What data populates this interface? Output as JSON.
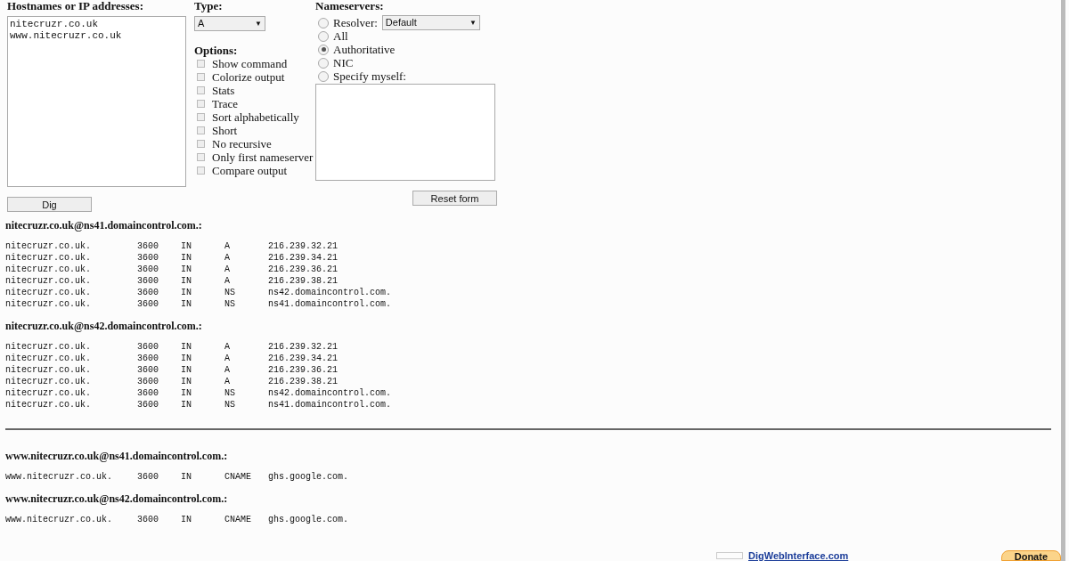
{
  "form": {
    "hostnames": {
      "label": "Hostnames or IP addresses:",
      "value": "nitecruzr.co.uk\nwww.nitecruzr.co.uk"
    },
    "dig_button": "Dig",
    "type": {
      "label": "Type:",
      "value": "A",
      "caret": "▼"
    },
    "options_label": "Options:",
    "options": [
      {
        "label": "Show command",
        "checked": false
      },
      {
        "label": "Colorize output",
        "checked": false
      },
      {
        "label": "Stats",
        "checked": false
      },
      {
        "label": "Trace",
        "checked": false
      },
      {
        "label": "Sort alphabetically",
        "checked": false
      },
      {
        "label": "Short",
        "checked": false
      },
      {
        "label": "No recursive",
        "checked": false
      },
      {
        "label": "Only first nameserver",
        "checked": false
      },
      {
        "label": "Compare output",
        "checked": false
      }
    ],
    "nameservers": {
      "label": "Nameservers:",
      "choices": [
        {
          "label": "Resolver:",
          "selected": false,
          "kind": "select",
          "value": "Default",
          "caret": "▼"
        },
        {
          "label": "All",
          "selected": false,
          "kind": "plain"
        },
        {
          "label": "Authoritative",
          "selected": true,
          "kind": "plain"
        },
        {
          "label": "NIC",
          "selected": false,
          "kind": "plain"
        },
        {
          "label": "Specify myself:",
          "selected": false,
          "kind": "plain"
        }
      ]
    },
    "reset_button": "Reset form"
  },
  "results": [
    {
      "sections": [
        {
          "header": "nitecruzr.co.uk@ns41.domaincontrol.com.:",
          "records": [
            [
              "nitecruzr.co.uk.",
              "3600",
              "IN",
              "A",
              "216.239.32.21"
            ],
            [
              "nitecruzr.co.uk.",
              "3600",
              "IN",
              "A",
              "216.239.34.21"
            ],
            [
              "nitecruzr.co.uk.",
              "3600",
              "IN",
              "A",
              "216.239.36.21"
            ],
            [
              "nitecruzr.co.uk.",
              "3600",
              "IN",
              "A",
              "216.239.38.21"
            ],
            [
              "nitecruzr.co.uk.",
              "3600",
              "IN",
              "NS",
              "ns42.domaincontrol.com."
            ],
            [
              "nitecruzr.co.uk.",
              "3600",
              "IN",
              "NS",
              "ns41.domaincontrol.com."
            ]
          ]
        },
        {
          "header": "nitecruzr.co.uk@ns42.domaincontrol.com.:",
          "records": [
            [
              "nitecruzr.co.uk.",
              "3600",
              "IN",
              "A",
              "216.239.32.21"
            ],
            [
              "nitecruzr.co.uk.",
              "3600",
              "IN",
              "A",
              "216.239.34.21"
            ],
            [
              "nitecruzr.co.uk.",
              "3600",
              "IN",
              "A",
              "216.239.36.21"
            ],
            [
              "nitecruzr.co.uk.",
              "3600",
              "IN",
              "A",
              "216.239.38.21"
            ],
            [
              "nitecruzr.co.uk.",
              "3600",
              "IN",
              "NS",
              "ns42.domaincontrol.com."
            ],
            [
              "nitecruzr.co.uk.",
              "3600",
              "IN",
              "NS",
              "ns41.domaincontrol.com."
            ]
          ]
        }
      ]
    },
    {
      "sections": [
        {
          "header": "www.nitecruzr.co.uk@ns41.domaincontrol.com.:",
          "records": [
            [
              "www.nitecruzr.co.uk.",
              "3600",
              "IN",
              "CNAME",
              "ghs.google.com."
            ]
          ]
        },
        {
          "header": "www.nitecruzr.co.uk@ns42.domaincontrol.com.:",
          "records": [
            [
              "www.nitecruzr.co.uk.",
              "3600",
              "IN",
              "CNAME",
              "ghs.google.com."
            ]
          ]
        }
      ]
    }
  ],
  "footer": {
    "link": "DigWebInterface.com",
    "donate": "Donate"
  }
}
